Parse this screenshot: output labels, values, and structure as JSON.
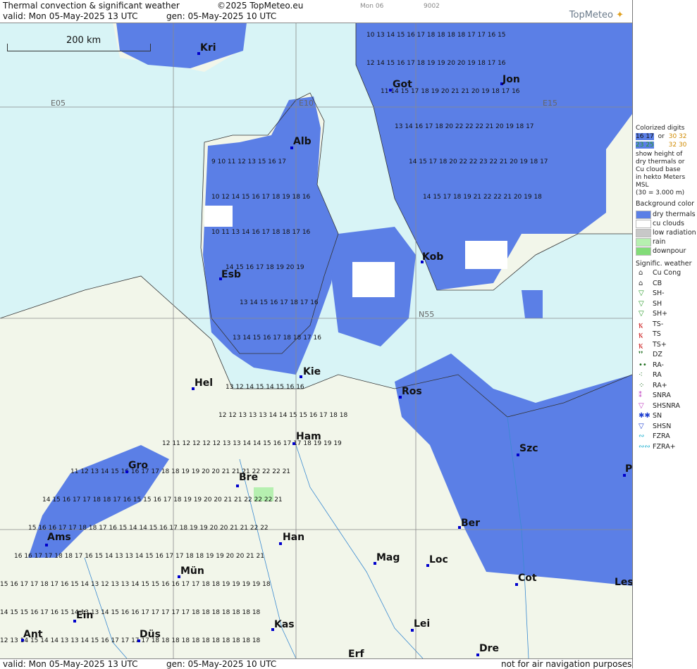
{
  "header": {
    "title": "Thermal convection & significant weather",
    "copyright": "©2025 TopMeteo.eu",
    "valid": "valid:  Mon  05-May-2025  13 UTC",
    "gen": "gen: 05-May-2025 10 UTC",
    "small_day": "Mon 06",
    "small_code": "9002",
    "logo": "TopMeteo"
  },
  "footer": {
    "valid": "valid:  Mon  05-May-2025  13 UTC",
    "gen": "gen: 05-May-2025 10 UTC",
    "note": "not for air navigation purposes"
  },
  "scale_label": "200 km",
  "grid_labels": [
    "E05",
    "E10",
    "E15",
    "N55"
  ],
  "cities": [
    "Kri",
    "Got",
    "Jon",
    "Alb",
    "Kob",
    "Esb",
    "Ros",
    "Kie",
    "Hel",
    "Ham",
    "Szc",
    "Gro",
    "Bre",
    "Ber",
    "Ams",
    "Han",
    "Mag",
    "Loc",
    "Mün",
    "Cot",
    "Les",
    "Ein",
    "Kas",
    "Lei",
    "Ant",
    "Düs",
    "Dre",
    "Erf",
    "P"
  ],
  "legend": {
    "colorized_title": "Colorized digits",
    "sample1": "16 17",
    "or": "or",
    "sample2": "30 32",
    "sample3": "23 25",
    "sample4": "32 30",
    "desc": [
      "show height of",
      "dry thermals or",
      "Cu cloud base",
      "in hekto Meters",
      "MSL",
      "(30 = 3.000 m)"
    ],
    "bg_title": "Background color",
    "bg_items": [
      {
        "label": "dry thermals",
        "color": "#5b7fe6"
      },
      {
        "label": "cu clouds",
        "color": "#ffffff"
      },
      {
        "label": "low radiation",
        "color": "#c8c8c8"
      },
      {
        "label": "rain",
        "color": "#b6f0b0"
      },
      {
        "label": "downpour",
        "color": "#82dc78"
      }
    ],
    "sig_title": "Signific. weather",
    "sig_items": [
      {
        "sym": "⌂",
        "label": "Cu Cong",
        "color": "#333333"
      },
      {
        "sym": "⌂",
        "label": "CB",
        "color": "#333333"
      },
      {
        "sym": "▽",
        "label": "SH-",
        "color": "#2a9a2a"
      },
      {
        "sym": "▽",
        "label": "SH",
        "color": "#2a9a2a"
      },
      {
        "sym": "▽",
        "label": "SH+",
        "color": "#2a9a2a"
      },
      {
        "sym": "Ꝅ",
        "label": "TS-",
        "color": "#d03030"
      },
      {
        "sym": "Ꝅ",
        "label": "TS",
        "color": "#d03030"
      },
      {
        "sym": "Ꝅ",
        "label": "TS+",
        "color": "#d03030"
      },
      {
        "sym": "❜❜",
        "label": "DZ",
        "color": "#1a6a1a"
      },
      {
        "sym": "••",
        "label": "RA-",
        "color": "#1a6a1a"
      },
      {
        "sym": "⁖",
        "label": "RA",
        "color": "#1a6a1a"
      },
      {
        "sym": "⁘",
        "label": "RA+",
        "color": "#1a6a1a"
      },
      {
        "sym": "⁑",
        "label": "SNRA",
        "color": "#c040c0"
      },
      {
        "sym": "▽",
        "label": "SHSNRA",
        "color": "#c040c0"
      },
      {
        "sym": "✱✱",
        "label": "SN",
        "color": "#2040d0"
      },
      {
        "sym": "▽",
        "label": "SHSN",
        "color": "#2040d0"
      },
      {
        "sym": "∾",
        "label": "FZRA",
        "color": "#20b0d0"
      },
      {
        "sym": "∾∾",
        "label": "FZRA+",
        "color": "#20b0d0"
      }
    ]
  }
}
